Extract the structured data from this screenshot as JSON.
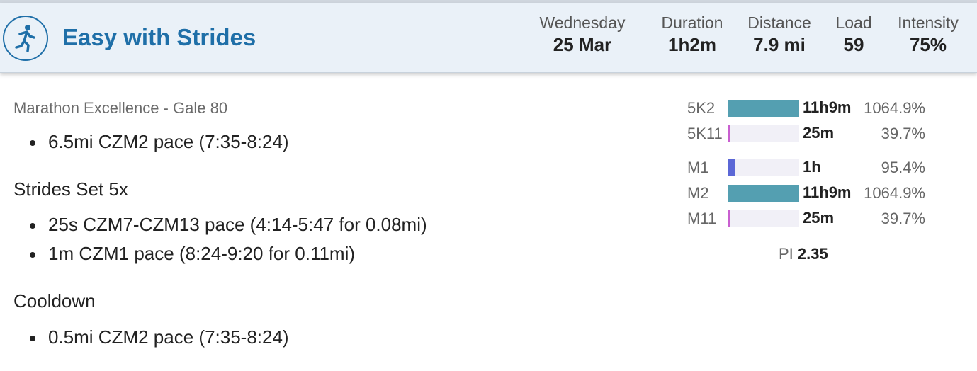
{
  "header": {
    "title": "Easy with Strides",
    "stats": [
      {
        "label": "Wednesday",
        "value": "25 Mar"
      },
      {
        "label": "Duration",
        "value": "1h2m"
      },
      {
        "label": "Distance",
        "value": "7.9 mi"
      },
      {
        "label": "Load",
        "value": "59"
      },
      {
        "label": "Intensity",
        "value": "75%"
      }
    ],
    "icon": "runner-icon",
    "accent_color": "#1f6fa8"
  },
  "workout": {
    "source": "Marathon Excellence - Gale 80",
    "main_steps": [
      "6.5mi CZM2 pace (7:35-8:24)"
    ],
    "strides_title": "Strides Set 5x",
    "strides_steps": [
      "25s CZM7-CZM13 pace (4:14-5:47 for 0.08mi)",
      "1m CZM1 pace (8:24-9:20 for 0.11mi)"
    ],
    "cooldown_title": "Cooldown",
    "cooldown_steps": [
      "0.5mi CZM2 pace (7:35-8:24)"
    ]
  },
  "zones": [
    {
      "label": "5K2",
      "time": "11h9m",
      "percent": "1064.9%",
      "fill": 1.0,
      "color": "#549fb1"
    },
    {
      "label": "5K11",
      "time": "25m",
      "percent": "39.7%",
      "fill": 0.02,
      "color": "#c95fd0"
    },
    {
      "label": "M1",
      "time": "1h",
      "percent": "95.4%",
      "fill": 0.09,
      "color": "#5b67d6"
    },
    {
      "label": "M2",
      "time": "11h9m",
      "percent": "1064.9%",
      "fill": 1.0,
      "color": "#549fb1"
    },
    {
      "label": "M11",
      "time": "25m",
      "percent": "39.7%",
      "fill": 0.02,
      "color": "#c95fd0"
    }
  ],
  "pi": {
    "label": "PI",
    "value": "2.35"
  }
}
